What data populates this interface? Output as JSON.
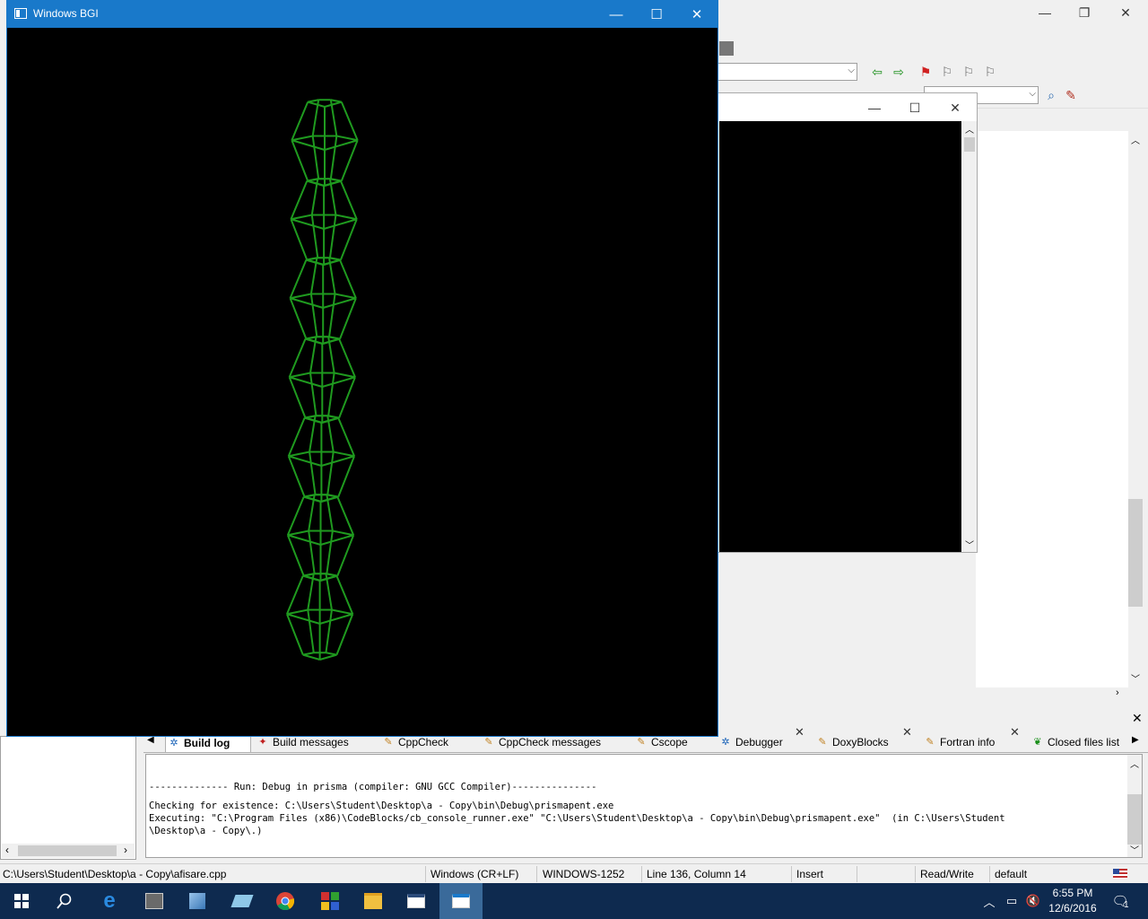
{
  "bgi_window": {
    "title": "Windows BGI",
    "minimize": "—",
    "maximize": "☐",
    "close": "✕"
  },
  "ide": {
    "minimize": "—",
    "restore": "❐",
    "close": "✕"
  },
  "console_window": {
    "minimize": "—",
    "maximize": "☐",
    "close": "✕"
  },
  "log_tabs": [
    {
      "label": "Build log",
      "icon": "gear-icon"
    },
    {
      "label": "Build messages",
      "icon": "build-icon"
    },
    {
      "label": "CppCheck",
      "icon": "pencil-icon"
    },
    {
      "label": "CppCheck messages",
      "icon": "pencil-icon"
    },
    {
      "label": "Cscope",
      "icon": "pencil-icon"
    },
    {
      "label": "Debugger",
      "icon": "gear-icon"
    },
    {
      "label": "DoxyBlocks",
      "icon": "pencil-icon"
    },
    {
      "label": "Fortran info",
      "icon": "pencil-icon"
    },
    {
      "label": "Closed files list",
      "icon": "leaf-icon"
    }
  ],
  "build_log": {
    "line1": "-------------- Run: Debug in prisma (compiler: GNU GCC Compiler)---------------",
    "line2": "Checking for existence: C:\\Users\\Student\\Desktop\\a - Copy\\bin\\Debug\\prismapent.exe",
    "line3": "Executing: \"C:\\Program Files (x86)\\CodeBlocks/cb_console_runner.exe\" \"C:\\Users\\Student\\Desktop\\a - Copy\\bin\\Debug\\prismapent.exe\"  (in C:\\Users\\Student",
    "line4": "\\Desktop\\a - Copy\\.)"
  },
  "status_bar": {
    "file": "C:\\Users\\Student\\Desktop\\a - Copy\\afisare.cpp",
    "eol": "Windows (CR+LF)",
    "encoding": "WINDOWS-1252",
    "position": "Line 136, Column 14",
    "mode": "Insert",
    "access": "Read/Write",
    "profile": "default"
  },
  "taskbar": {
    "time": "6:55 PM",
    "date": "12/6/2016",
    "notification_count": "1"
  },
  "colors": {
    "wireframe": "#1f9a1f",
    "bgi_title": "#1979ca",
    "taskbar": "#0e2a4f"
  },
  "drawing": {
    "segments": 7,
    "shape": "stacked pentagonal prism wireframes"
  }
}
